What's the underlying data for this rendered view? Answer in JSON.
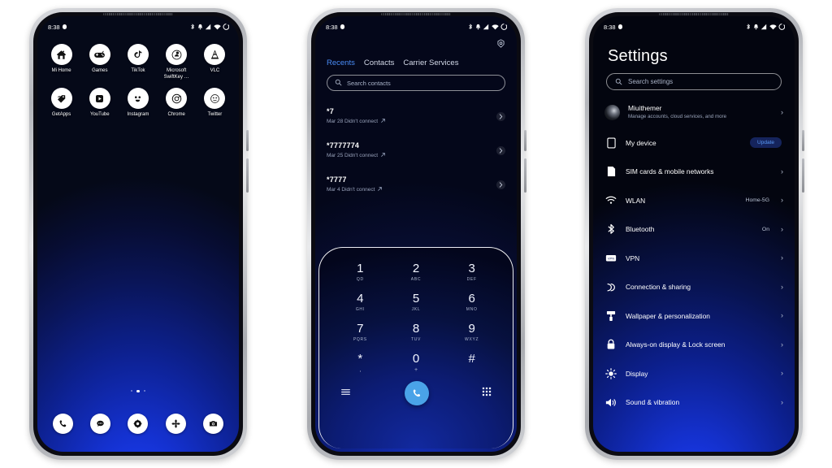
{
  "statusbar": {
    "time": "8:38",
    "icons": [
      "record-dot-icon",
      "bluetooth-icon",
      "alarm-icon",
      "signal-icon",
      "wifi-icon",
      "battery-icon"
    ]
  },
  "home": {
    "apps_row1": [
      {
        "label": "Mi Home",
        "icon": "home-icon"
      },
      {
        "label": "Games",
        "icon": "gamepad-icon"
      },
      {
        "label": "TikTok",
        "icon": "music-note-icon"
      },
      {
        "label": "Microsoft SwiftKey …",
        "icon": "keyboard-icon"
      },
      {
        "label": "VLC",
        "icon": "traffic-cone-icon"
      }
    ],
    "apps_row2": [
      {
        "label": "GetApps",
        "icon": "price-tag-icon"
      },
      {
        "label": "YouTube",
        "icon": "video-play-icon"
      },
      {
        "label": "Instagram",
        "icon": "camera-face-icon"
      },
      {
        "label": "Chrome",
        "icon": "chrome-circle-icon"
      },
      {
        "label": "Twitter",
        "icon": "bird-icon"
      }
    ],
    "page_dots": 3,
    "active_dot": 1,
    "dock": [
      {
        "name": "Phone",
        "icon": "phone-icon"
      },
      {
        "name": "Messages",
        "icon": "chat-bubble-icon"
      },
      {
        "name": "Browser",
        "icon": "compass-icon"
      },
      {
        "name": "Themes",
        "icon": "flower-icon"
      },
      {
        "name": "Camera",
        "icon": "camera-icon"
      }
    ]
  },
  "dialer": {
    "settings_icon": "gear-icon",
    "tabs": [
      {
        "label": "Recents",
        "active": true
      },
      {
        "label": "Contacts",
        "active": false
      },
      {
        "label": "Carrier Services",
        "active": false
      }
    ],
    "search_placeholder": "Search contacts",
    "accent_color": "#4a8cf7",
    "calls": [
      {
        "number": "*7",
        "detail": "Mar 28 Didn't connect",
        "direction": "outgoing-arrow-icon"
      },
      {
        "number": "*7777774",
        "detail": "Mar 25 Didn't connect",
        "direction": "outgoing-arrow-icon"
      },
      {
        "number": "*7777",
        "detail": "Mar 4 Didn't connect",
        "direction": "outgoing-arrow-icon"
      }
    ],
    "keypad": [
      {
        "digit": "1",
        "sub": "QD"
      },
      {
        "digit": "2",
        "sub": "ABC"
      },
      {
        "digit": "3",
        "sub": "DEF"
      },
      {
        "digit": "4",
        "sub": "GHI"
      },
      {
        "digit": "5",
        "sub": "JKL"
      },
      {
        "digit": "6",
        "sub": "MNO"
      },
      {
        "digit": "7",
        "sub": "PQRS"
      },
      {
        "digit": "8",
        "sub": "TUV"
      },
      {
        "digit": "9",
        "sub": "WXYZ"
      },
      {
        "digit": "*",
        "sub": ","
      },
      {
        "digit": "0",
        "sub": "+"
      },
      {
        "digit": "#",
        "sub": ""
      }
    ],
    "actions": {
      "menu_icon": "hamburger-menu-icon",
      "call_icon": "phone-icon",
      "keypad_icon": "dialpad-grid-icon",
      "call_button_color": "#4aa3e8"
    }
  },
  "settings": {
    "title": "Settings",
    "search_placeholder": "Search settings",
    "items": [
      {
        "label": "Miuithemer",
        "sub": "Manage accounts, cloud services, and more",
        "icon": "avatar",
        "value": "",
        "badge": "",
        "chevron": true
      },
      {
        "label": "My device",
        "sub": "",
        "icon": "device-icon",
        "value": "",
        "badge": "Update",
        "chevron": false
      },
      {
        "label": "SIM cards & mobile networks",
        "sub": "",
        "icon": "sim-card-icon",
        "value": "",
        "badge": "",
        "chevron": true
      },
      {
        "label": "WLAN",
        "sub": "",
        "icon": "wifi-icon",
        "value": "Home-5G",
        "badge": "",
        "chevron": true
      },
      {
        "label": "Bluetooth",
        "sub": "",
        "icon": "bluetooth-icon",
        "value": "On",
        "badge": "",
        "chevron": true
      },
      {
        "label": "VPN",
        "sub": "",
        "icon": "vpn-icon",
        "value": "",
        "badge": "",
        "chevron": true
      },
      {
        "label": "Connection & sharing",
        "sub": "",
        "icon": "connection-sharing-icon",
        "value": "",
        "badge": "",
        "chevron": true
      },
      {
        "label": "Wallpaper & personalization",
        "sub": "",
        "icon": "paint-roller-icon",
        "value": "",
        "badge": "",
        "chevron": true
      },
      {
        "label": "Always-on display & Lock screen",
        "sub": "",
        "icon": "lock-icon",
        "value": "",
        "badge": "",
        "chevron": true
      },
      {
        "label": "Display",
        "sub": "",
        "icon": "brightness-icon",
        "value": "",
        "badge": "",
        "chevron": true
      },
      {
        "label": "Sound & vibration",
        "sub": "",
        "icon": "speaker-icon",
        "value": "",
        "badge": "",
        "chevron": true
      }
    ],
    "badge_color": "#5b9cf8"
  }
}
